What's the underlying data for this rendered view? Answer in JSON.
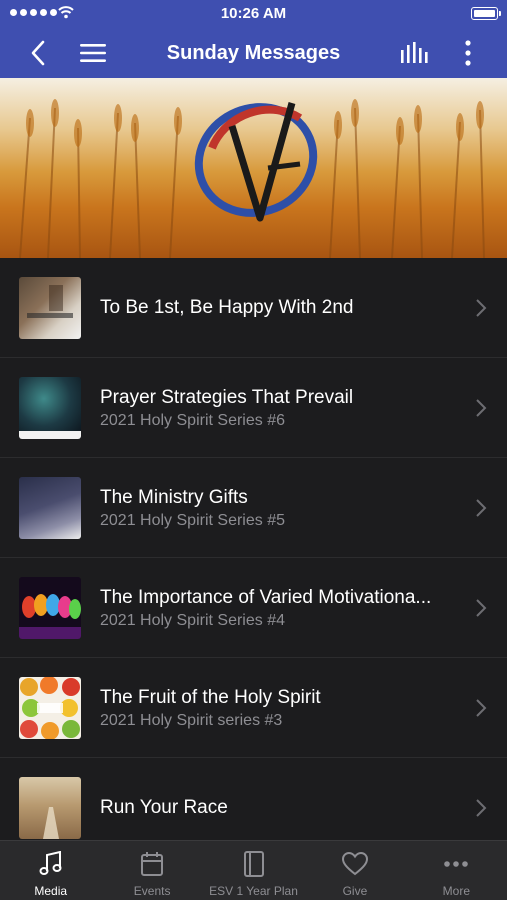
{
  "status": {
    "time": "10:26 AM"
  },
  "header": {
    "title": "Sunday Messages"
  },
  "icons": {
    "back": "chevron-left-icon",
    "menu": "hamburger-menu-icon",
    "equalizer": "equalizer-icon",
    "more": "vertical-ellipsis-icon"
  },
  "colors": {
    "header": "#3f4fb0",
    "list_bg": "#1c1c1e",
    "tabbar_bg": "#2a2a2c",
    "subtitle": "#8e8e93"
  },
  "messages": [
    {
      "title": "To Be 1st, Be Happy With 2nd",
      "subtitle": ""
    },
    {
      "title": "Prayer Strategies That Prevail",
      "subtitle": "2021 Holy Spirit Series #6"
    },
    {
      "title": "The Ministry Gifts",
      "subtitle": "2021 Holy Spirit Series #5"
    },
    {
      "title": "The Importance of Varied Motivationa...",
      "subtitle": "2021 Holy Spirit Series #4"
    },
    {
      "title": "The Fruit of the Holy Spirit",
      "subtitle": "2021 Holy Spirit series #3"
    },
    {
      "title": "Run Your Race",
      "subtitle": ""
    }
  ],
  "tabs": [
    {
      "label": "Media",
      "icon": "music-note-icon",
      "active": true
    },
    {
      "label": "Events",
      "icon": "calendar-icon",
      "active": false
    },
    {
      "label": "ESV 1 Year Plan",
      "icon": "book-icon",
      "active": false
    },
    {
      "label": "Give",
      "icon": "heart-icon",
      "active": false
    },
    {
      "label": "More",
      "icon": "more-dots-icon",
      "active": false
    }
  ]
}
